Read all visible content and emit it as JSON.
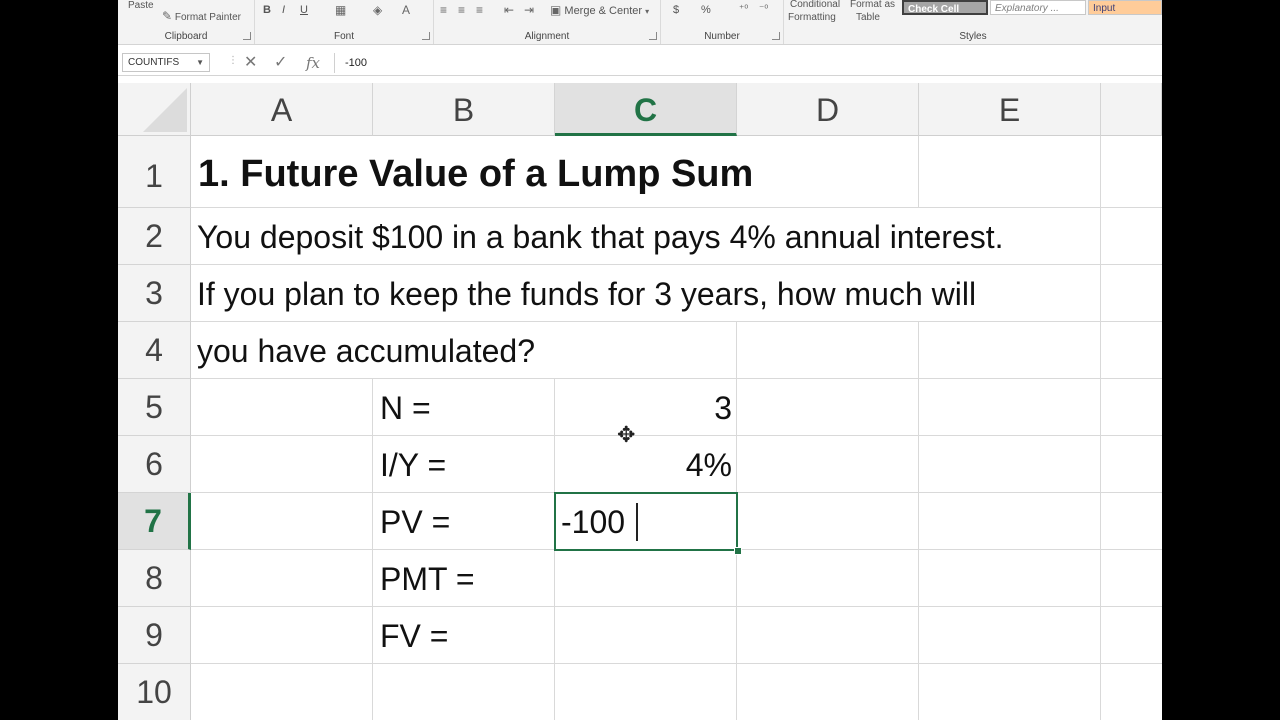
{
  "ribbon": {
    "clipboard": {
      "paste": "Paste",
      "format_painter": "Format Painter",
      "label": "Clipboard"
    },
    "font": {
      "bold": "B",
      "italic": "I",
      "underline": "U",
      "label": "Font"
    },
    "alignment": {
      "merge_center": "Merge & Center",
      "label": "Alignment"
    },
    "number": {
      "currency": "$",
      "percent": "%",
      "label": "Number"
    },
    "styles": {
      "conditional_1": "Conditional",
      "conditional_2": "Formatting",
      "format_as_1": "Format as",
      "format_as_2": "Table",
      "check_cell": "Check Cell",
      "explanatory": "Explanatory ...",
      "input": "Input",
      "label": "Styles"
    }
  },
  "formula_bar": {
    "name_box": "COUNTIFS",
    "cancel_icon": "✕",
    "enter_icon": "✓",
    "fx_label": "fx",
    "content": "-100"
  },
  "columns": [
    "A",
    "B",
    "C",
    "D",
    "E"
  ],
  "active_column": "C",
  "rows": [
    "1",
    "2",
    "3",
    "4",
    "5",
    "6",
    "7",
    "8",
    "9",
    "10"
  ],
  "active_row": "7",
  "cells": {
    "A1": "1. Future Value of a Lump Sum",
    "A2": "You deposit $100  in a bank that pays 4% annual interest.",
    "A3": "If you plan to keep the funds for 3 years, how much will",
    "A4": "you have accumulated?",
    "B5": "N =",
    "C5": "3",
    "B6": "I/Y =",
    "C6": "4%",
    "B7": "PV =",
    "C7": "-100",
    "B8": "PMT =",
    "B9": "FV ="
  },
  "colors": {
    "accent": "#217346",
    "header_bg": "#f3f3f3",
    "gridline": "#d9d9d9"
  }
}
